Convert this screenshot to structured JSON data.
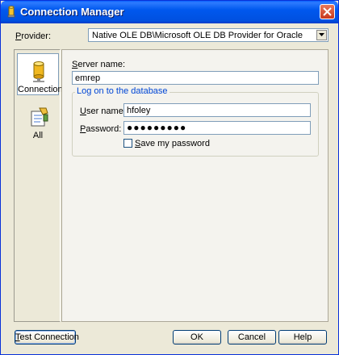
{
  "window": {
    "title": "Connection Manager"
  },
  "provider": {
    "label": "Provider:",
    "value": "Native OLE DB\\Microsoft OLE DB Provider for Oracle"
  },
  "nav": [
    {
      "label": "Connection",
      "icon": "database-cylinder-icon",
      "selected": true
    },
    {
      "label": "All",
      "icon": "properties-icon",
      "selected": false
    }
  ],
  "server": {
    "label": "Server name:",
    "value": "emrep"
  },
  "logon": {
    "group_label": "Log on to the database",
    "user_label": "User name:",
    "user_value": "hfoley",
    "password_label": "Password:",
    "password_value": "●●●●●●●●●",
    "save_label": "Save my password",
    "save_checked": false
  },
  "buttons": {
    "test": "Test Connection",
    "ok": "OK",
    "cancel": "Cancel",
    "help": "Help"
  },
  "colors": {
    "titlebar": "#0058ee",
    "dialog": "#ece9d8",
    "group_title": "#0046d5"
  }
}
